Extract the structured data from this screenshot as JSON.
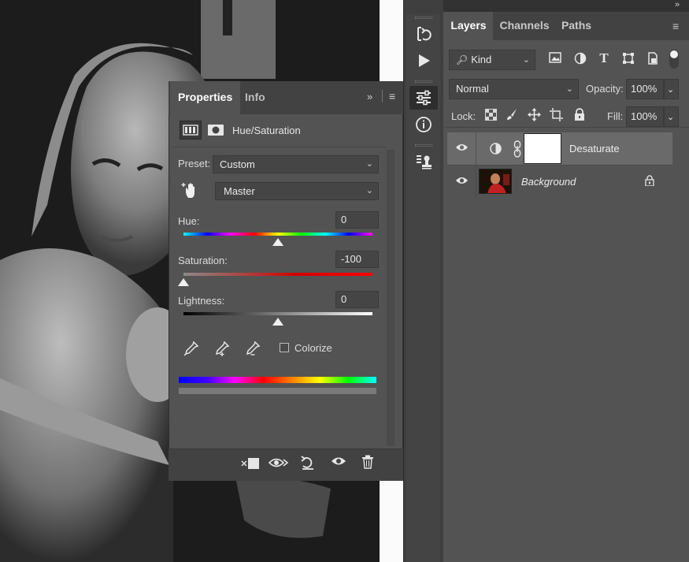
{
  "layers_panel": {
    "tabs": [
      "Layers",
      "Channels",
      "Paths"
    ],
    "filter_kind": "Kind",
    "blend_mode": "Normal",
    "opacity_label": "Opacity:",
    "opacity_value": "100%",
    "lock_label": "Lock:",
    "fill_label": "Fill:",
    "fill_value": "100%",
    "layers": [
      {
        "name": "Desaturate",
        "selected": true
      },
      {
        "name": "Background",
        "locked": true
      }
    ]
  },
  "properties_panel": {
    "tabs": [
      "Properties",
      "Info"
    ],
    "adjustment_title": "Hue/Saturation",
    "preset_label": "Preset:",
    "preset_value": "Custom",
    "channel_value": "Master",
    "hue_label": "Hue:",
    "hue_value": "0",
    "saturation_label": "Saturation:",
    "saturation_value": "-100",
    "lightness_label": "Lightness:",
    "lightness_value": "0",
    "colorize_label": "Colorize",
    "colorize_checked": false
  },
  "icons": {
    "collapse": "«",
    "expand": "»",
    "menu": "≡"
  },
  "colors": {
    "panel_bg": "#535353",
    "tab_bar": "#424242",
    "accent_white": "#ffffff"
  }
}
